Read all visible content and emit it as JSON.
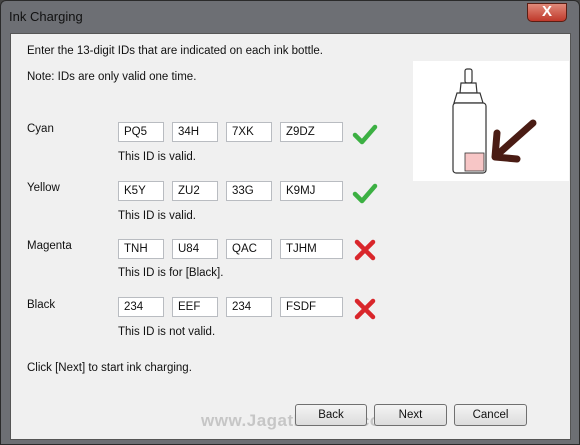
{
  "window": {
    "title": "Ink Charging",
    "close_label": "X"
  },
  "instructions": {
    "line1": "Enter the 13-digit IDs that are indicated on each ink bottle.",
    "line2": "Note: IDs are only valid one time.",
    "footer": "Click [Next] to start ink charging."
  },
  "rows": [
    {
      "name": "Cyan",
      "ids": [
        "PQ5",
        "34H",
        "7XK",
        "Z9DZ"
      ],
      "status": "This ID is valid.",
      "result": "valid"
    },
    {
      "name": "Yellow",
      "ids": [
        "K5Y",
        "ZU2",
        "33G",
        "K9MJ"
      ],
      "status": "This ID is valid.",
      "result": "valid"
    },
    {
      "name": "Magenta",
      "ids": [
        "TNH",
        "U84",
        "QAC",
        "TJHM"
      ],
      "status": "This ID is for [Black].",
      "result": "invalid"
    },
    {
      "name": "Black",
      "ids": [
        "234",
        "EEF",
        "234",
        "FSDF"
      ],
      "status": "This ID is not valid.",
      "result": "invalid"
    }
  ],
  "buttons": {
    "back": "Back",
    "next": "Next",
    "cancel": "Cancel"
  },
  "watermark": "www.JagatReview.com",
  "colors": {
    "valid": "#3cb043",
    "invalid": "#d9262b"
  }
}
